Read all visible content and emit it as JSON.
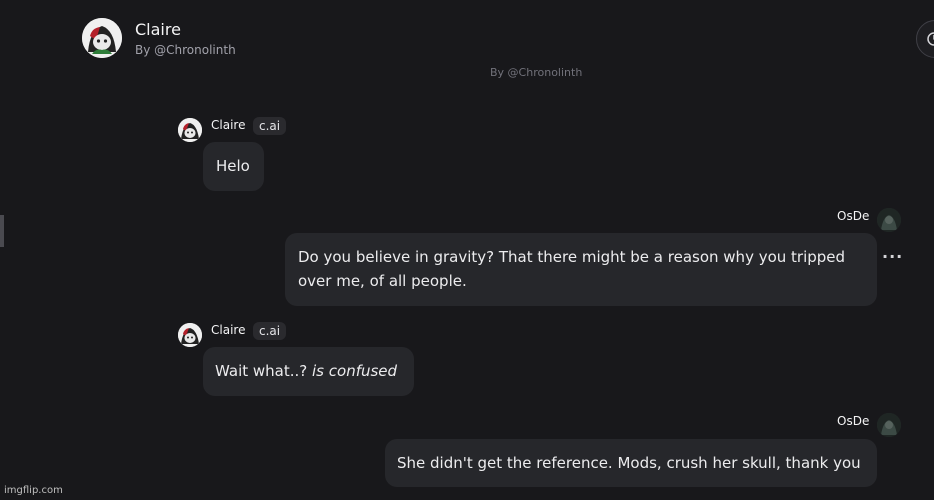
{
  "header": {
    "character_name": "Claire",
    "creator": "By @Chronolinth",
    "scroll_hint": "By @Chronolinth"
  },
  "messages": [
    {
      "sender": "Claire",
      "badge": "c.ai",
      "text": "Helo",
      "avatar_icon": "character-avatar"
    },
    {
      "sender": "OsDe",
      "text": "Do you believe in gravity? That there might be a reason why you tripped over me, of all people.",
      "menu_label": "···",
      "avatar_icon": "user-avatar"
    },
    {
      "sender": "Claire",
      "badge": "c.ai",
      "text": "Wait what..?",
      "text_italic": "is confused",
      "avatar_icon": "character-avatar"
    },
    {
      "sender": "OsDe",
      "text": "She didn't get the reference. Mods, crush her skull, thank you",
      "avatar_icon": "user-avatar"
    }
  ],
  "watermark": "imgflip.com",
  "colors": {
    "background": "#18181b",
    "bubble": "#26272b",
    "badge": "#2a2a2e"
  }
}
